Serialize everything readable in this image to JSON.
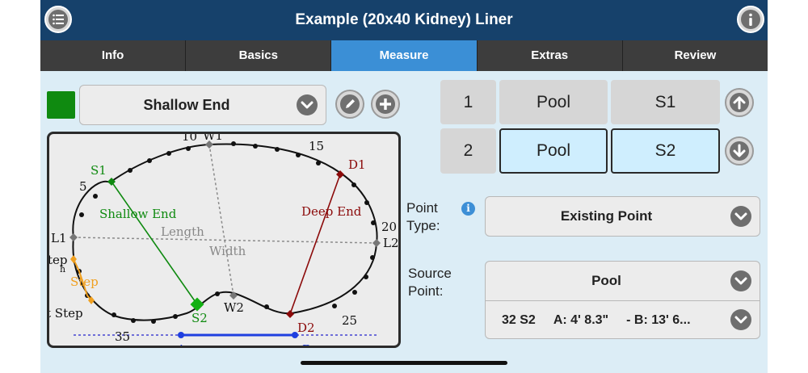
{
  "header": {
    "title": "Example (20x40 Kidney) Liner"
  },
  "tabs": [
    {
      "label": "Info"
    },
    {
      "label": "Basics"
    },
    {
      "label": "Measure"
    },
    {
      "label": "Extras"
    },
    {
      "label": "Review"
    }
  ],
  "active_tab": "Measure",
  "area": {
    "selected": "Shallow End",
    "swatch_color": "#0f8a10"
  },
  "diagram": {
    "labels": {
      "s1": "S1",
      "s2": "S2",
      "d1": "D1",
      "d2": "D2",
      "w1": "W1",
      "w2": "W2",
      "l1": "L1",
      "l2": "L2",
      "n5": "5",
      "n10": "10",
      "n15": "15",
      "n20": "20",
      "n25": "25",
      "n35": "35",
      "shallow_end": "Shallow End",
      "deep_end": "Deep End",
      "length": "Length",
      "width": "Width",
      "step": "Step",
      "step_top": "tep",
      "step_bottom": "t Step",
      "step_small": "h",
      "bar_a": "A",
      "bar_b": "B"
    }
  },
  "points": [
    {
      "index": "1",
      "source": "Pool",
      "name": "S1"
    },
    {
      "index": "2",
      "source": "Pool",
      "name": "S2"
    }
  ],
  "point_type": {
    "label_line1": "Point",
    "label_line2": "Type:",
    "value": "Existing Point"
  },
  "source_point": {
    "label_line1": "Source",
    "label_line2": "Point:",
    "value": "Pool",
    "detail_id": "32 S2",
    "detail_a": "A: 4' 8.3\"",
    "detail_b": "- B: 13' 6..."
  },
  "icons": {
    "menu": "list-menu-icon",
    "info": "info-icon",
    "edit": "pencil-icon",
    "add": "plus-icon",
    "up": "arrow-up-icon",
    "down": "arrow-down-icon",
    "chevron": "chevron-down-icon"
  }
}
